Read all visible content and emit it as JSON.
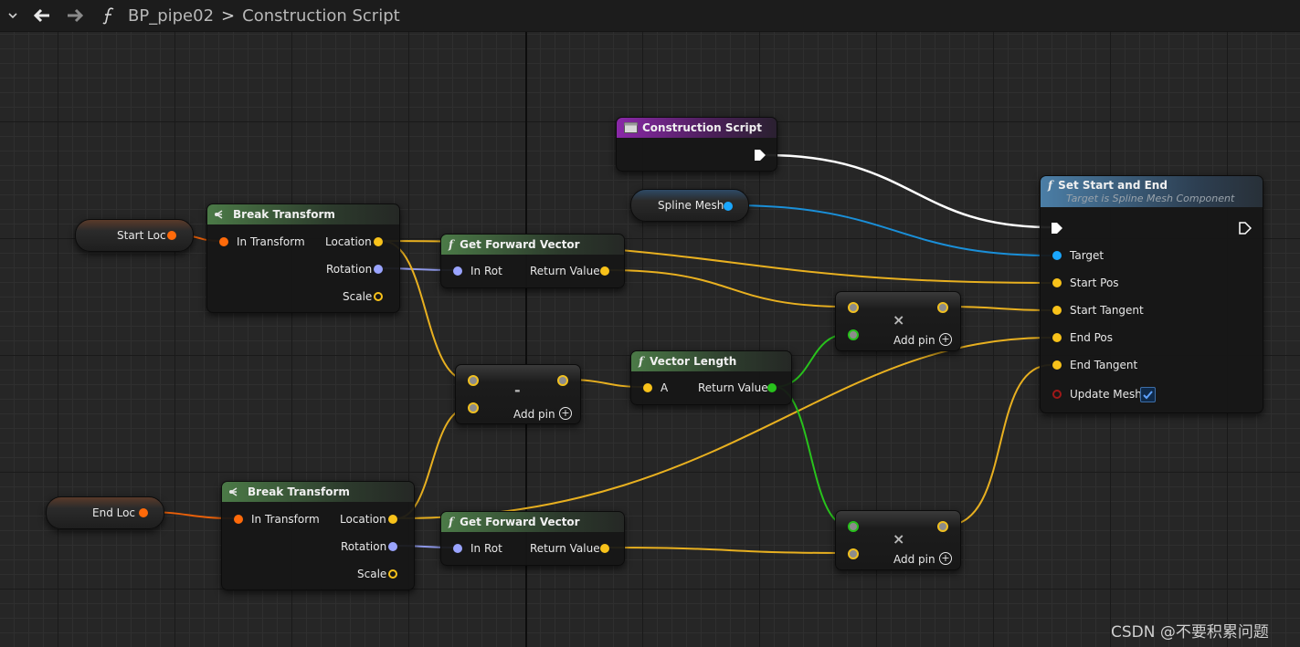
{
  "topbar": {
    "blueprint": "BP_pipe02",
    "separator": ">",
    "graph_name": "Construction Script"
  },
  "nodes": {
    "construction_script": {
      "title": "Construction Script"
    },
    "spline_mesh": {
      "label": "Spline Mesh"
    },
    "start_loc": {
      "label": "Start Loc"
    },
    "end_loc": {
      "label": "End Loc"
    },
    "break_transform_1": {
      "title": "Break Transform",
      "in": "In Transform",
      "location": "Location",
      "rotation": "Rotation",
      "scale": "Scale"
    },
    "break_transform_2": {
      "title": "Break Transform",
      "in": "In Transform",
      "location": "Location",
      "rotation": "Rotation",
      "scale": "Scale"
    },
    "get_forward_vector_1": {
      "title": "Get Forward Vector",
      "in": "In Rot",
      "out": "Return Value"
    },
    "get_forward_vector_2": {
      "title": "Get Forward Vector",
      "in": "In Rot",
      "out": "Return Value"
    },
    "subtract": {
      "symbol": "-",
      "add_pin": "Add pin"
    },
    "vector_length": {
      "title": "Vector Length",
      "in": "A",
      "out": "Return Value"
    },
    "multiply_1": {
      "symbol": "×",
      "add_pin": "Add pin"
    },
    "multiply_2": {
      "symbol": "×",
      "add_pin": "Add pin"
    },
    "set_start_end": {
      "title": "Set Start and End",
      "subtitle": "Target is Spline Mesh Component",
      "pins": [
        "Target",
        "Start Pos",
        "Start Tangent",
        "End Pos",
        "End Tangent",
        "Update Mesh"
      ],
      "update_mesh_checked": true
    }
  },
  "icons": {
    "function": "f",
    "event": "event-icon",
    "break": "break-struct-icon"
  },
  "colors": {
    "exec": "#ffffff",
    "struct_transform": "#ff6a0a",
    "vector": "#f8c21a",
    "rotator": "#9aa4ff",
    "object": "#1aa7ff",
    "float": "#28c21c",
    "bool": "#a01818"
  },
  "watermark": "CSDN @不要积累问题"
}
